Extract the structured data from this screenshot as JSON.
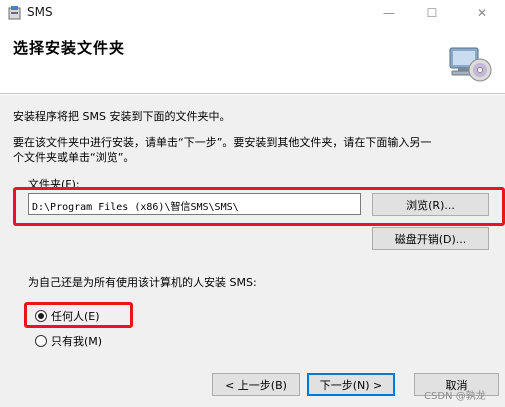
{
  "window": {
    "title": "SMS",
    "minimize_glyph": "—",
    "maximize_glyph": "☐",
    "close_glyph": "✕"
  },
  "header": {
    "title": "选择安装文件夹",
    "icon": "setup-disc-computer-icon"
  },
  "body": {
    "intro": "安装程序将把 SMS 安装到下面的文件夹中。",
    "instructions_line1": "要在该文件夹中进行安装，请单击“下一步”。要安装到其他文件夹，请在下面输入另一",
    "instructions_line2": "个文件夹或单击“浏览”。",
    "folder_label": "文件夹(F):",
    "folder_value": "D:\\Program Files (x86)\\智信SMS\\SMS\\",
    "browse_button": "浏览(R)...",
    "disk_cost_button": "磁盘开销(D)...",
    "install_for_question": "为自己还是为所有使用该计算机的人安装 SMS:",
    "radio_anyone": "任何人(E)",
    "radio_only_me": "只有我(M)",
    "selected_option": "任何人(E)"
  },
  "footer": {
    "back_button": "< 上一步(B)",
    "next_button": "下一步(N) >",
    "cancel_button": "取消",
    "watermark": "CSDN @孰龙"
  },
  "colors": {
    "highlight_red": "#e8141e",
    "focus_blue": "#0078d7",
    "body_background": "#f0f0f0"
  }
}
